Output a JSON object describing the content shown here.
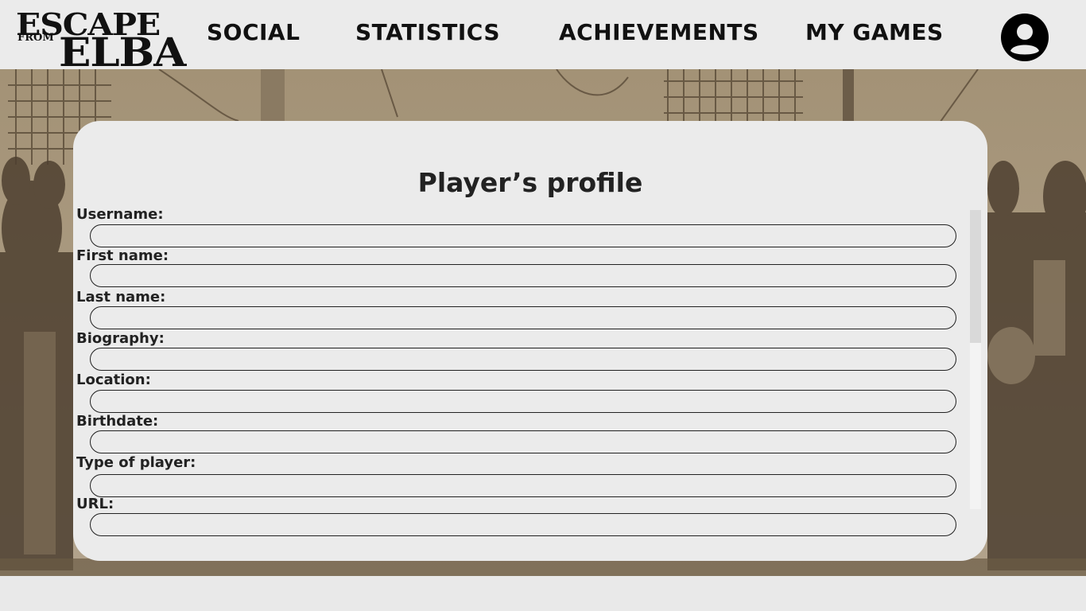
{
  "header": {
    "logo": {
      "escape": "ESCAPE",
      "from": "FROM",
      "elba": "ELBA"
    },
    "nav": [
      {
        "label": "SOCIAL"
      },
      {
        "label": "STATISTICS"
      },
      {
        "label": "ACHIEVEMENTS"
      },
      {
        "label": "MY GAMES"
      }
    ],
    "avatar_icon": "user-account-icon"
  },
  "profile": {
    "title": "Player’s profile",
    "fields": [
      {
        "label": "Username:",
        "value": ""
      },
      {
        "label": "First name:",
        "value": ""
      },
      {
        "label": "Last name:",
        "value": ""
      },
      {
        "label": "Biography:",
        "value": ""
      },
      {
        "label": "Location:",
        "value": ""
      },
      {
        "label": "Birthdate:",
        "value": ""
      },
      {
        "label": "Type of player:",
        "value": ""
      },
      {
        "label": "URL:",
        "value": ""
      }
    ]
  },
  "colors": {
    "header_bg": "#ebebeb",
    "card_bg": "#ebebeb",
    "scene_sepia": "#a89880",
    "text": "#222222"
  }
}
